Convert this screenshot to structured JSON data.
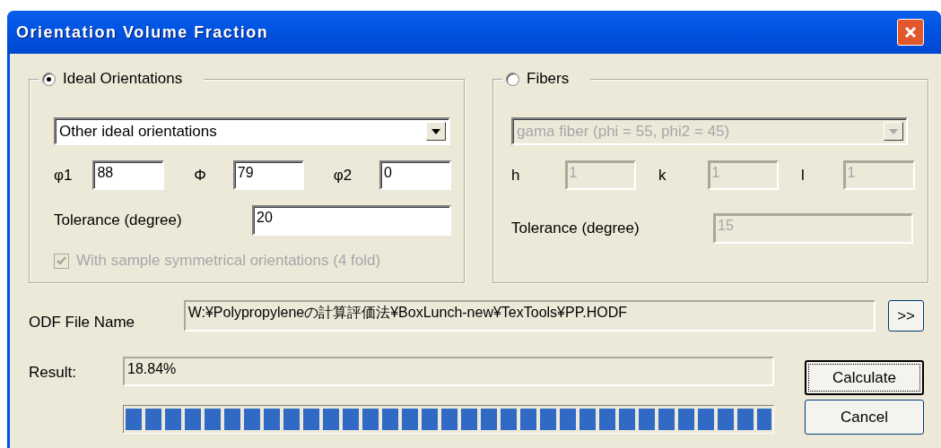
{
  "window": {
    "title": "Orientation Volume Fraction"
  },
  "ideal": {
    "label": "Ideal Orientations",
    "selected": true,
    "combo": {
      "value": "Other ideal orientations",
      "disabled": false
    },
    "angles": [
      {
        "label": "φ1",
        "value": "88",
        "disabled": false
      },
      {
        "label": "Φ",
        "value": "79",
        "disabled": false
      },
      {
        "label": "φ2",
        "value": "0",
        "disabled": false
      }
    ],
    "tolerance": {
      "label": "Tolerance (degree)",
      "value": "20",
      "disabled": false
    },
    "symmetry": {
      "label": "With sample symmetrical orientations (4 fold)",
      "checked": true,
      "disabled": true
    }
  },
  "fibers": {
    "label": "Fibers",
    "selected": false,
    "combo": {
      "value": "gama fiber (phi = 55, phi2 = 45)",
      "disabled": true
    },
    "indices": [
      {
        "label": "h",
        "value": "1",
        "disabled": true
      },
      {
        "label": "k",
        "value": "1",
        "disabled": true
      },
      {
        "label": "l",
        "value": "1",
        "disabled": true
      }
    ],
    "tolerance": {
      "label": "Tolerance (degree)",
      "value": "15",
      "disabled": true
    }
  },
  "odf_file": {
    "label": "ODF File Name",
    "value": "W:¥Polypropyleneの計算評価法¥BoxLunch-new¥TexTools¥PP.HODF",
    "browse_button": ">>"
  },
  "result": {
    "label": "Result:",
    "value": "18.84%",
    "progress": {
      "level": 1
    }
  },
  "buttons": [
    {
      "label": "Calculate",
      "focused": true
    },
    {
      "label": "Cancel",
      "focused": false
    }
  ]
}
